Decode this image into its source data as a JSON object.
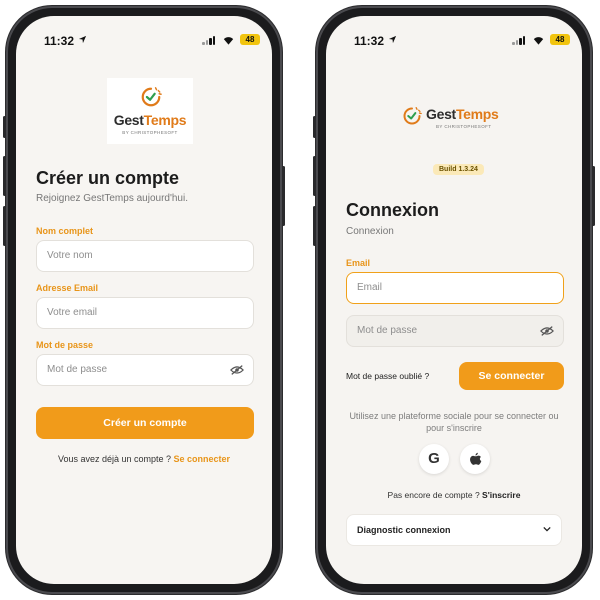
{
  "status": {
    "time": "11:32",
    "battery": "48"
  },
  "brand": {
    "name_part1": "Gest",
    "name_part2": "Temps",
    "byline": "BY CHRISTOPHESOFT",
    "accent_color": "#e07b1a"
  },
  "signup": {
    "title": "Créer un compte",
    "subtitle": "Rejoignez GestTemps aujourd'hui.",
    "name_label": "Nom complet",
    "name_placeholder": "Votre nom",
    "email_label": "Adresse Email",
    "email_placeholder": "Votre email",
    "password_label": "Mot de passe",
    "password_placeholder": "Mot de passe",
    "submit_label": "Créer un compte",
    "have_account_text": "Vous avez déjà un compte ?",
    "login_link": "Se connecter"
  },
  "login": {
    "build": "Build 1.3.24",
    "title": "Connexion",
    "subtitle": "Connexion",
    "email_label": "Email",
    "email_placeholder": "Email",
    "password_placeholder": "Mot de passe",
    "forgot_label": "Mot de passe oublié ?",
    "submit_label": "Se connecter",
    "social_text": "Utilisez une plateforme sociale pour se connecter ou pour s'inscrire",
    "google_label": "G",
    "no_account_text": "Pas encore de compte ?",
    "signup_link": "S'inscrire",
    "diagnostic_label": "Diagnostic connexion"
  },
  "colors": {
    "primary": "#f19b1a",
    "label": "#e8951a"
  }
}
